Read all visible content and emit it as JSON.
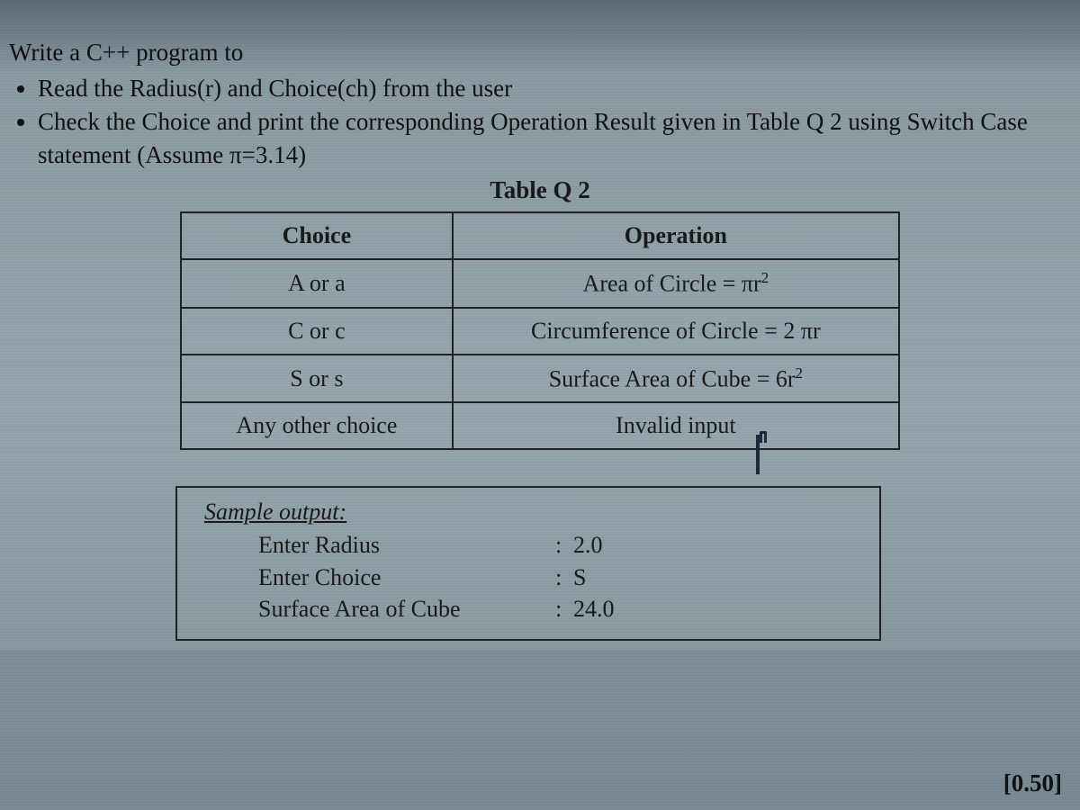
{
  "intro": {
    "line1": "Write a C++ program to",
    "bullet1": "Read the Radius(r) and Choice(ch) from the user",
    "bullet2": "Check the Choice and print the corresponding Operation Result given in Table Q 2 using Switch Case statement (Assume π=3.14)"
  },
  "table": {
    "title": "Table Q 2",
    "headers": {
      "choice": "Choice",
      "operation": "Operation"
    },
    "rows": [
      {
        "choice": "A or a",
        "operation_html": "Area of Circle = πr<sup>2</sup>"
      },
      {
        "choice": "C or c",
        "operation_html": "Circumference of Circle = 2 πr"
      },
      {
        "choice": "S or s",
        "operation_html": "Surface Area of Cube = 6r<sup>2</sup>"
      },
      {
        "choice": "Any other choice",
        "operation_html": "Invalid input"
      }
    ]
  },
  "sample": {
    "title": "Sample output:",
    "rows": [
      {
        "label": "Enter Radius",
        "value": "2.0"
      },
      {
        "label": "Enter Choice",
        "value": "S"
      },
      {
        "label": "Surface Area of Cube",
        "value": "24.0"
      }
    ]
  },
  "marks": "[0.50]"
}
